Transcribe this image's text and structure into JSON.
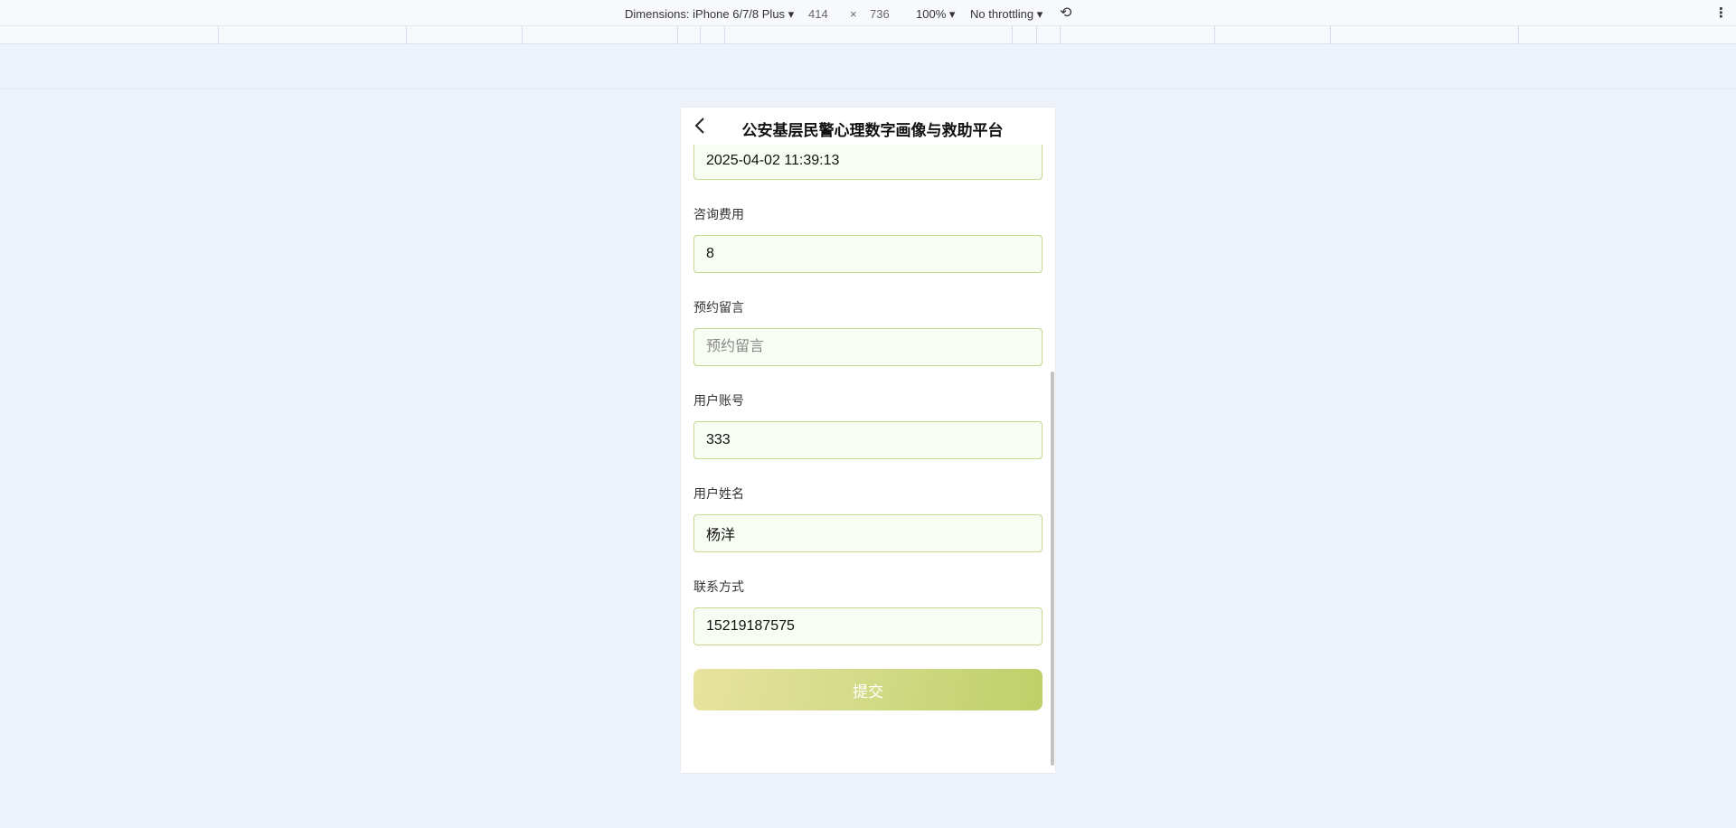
{
  "devtools": {
    "dimensions_label": "Dimensions: iPhone 6/7/8 Plus ▾",
    "width": "414",
    "times": "×",
    "height": "736",
    "zoom": "100% ▾",
    "throttling": "No throttling ▾",
    "rotate_icon": "rotate-icon",
    "more_icon": "more-vert-icon"
  },
  "header": {
    "title": "公安基层民警心理数字画像与救助平台",
    "back_icon": "chevron-left-icon"
  },
  "form": {
    "time_value": "2025-04-02 11:39:13",
    "fields": [
      {
        "label": "咨询费用",
        "value": "8",
        "placeholder": ""
      },
      {
        "label": "预约留言",
        "value": "",
        "placeholder": "预约留言"
      },
      {
        "label": "用户账号",
        "value": "333",
        "placeholder": ""
      },
      {
        "label": "用户姓名",
        "value": "杨洋",
        "placeholder": ""
      },
      {
        "label": "联系方式",
        "value": "15219187575",
        "placeholder": ""
      }
    ],
    "submit_label": "提交"
  },
  "colors": {
    "accent_start": "#e8e39f",
    "accent_end": "#bed069",
    "input_border": "#c6d88e"
  }
}
